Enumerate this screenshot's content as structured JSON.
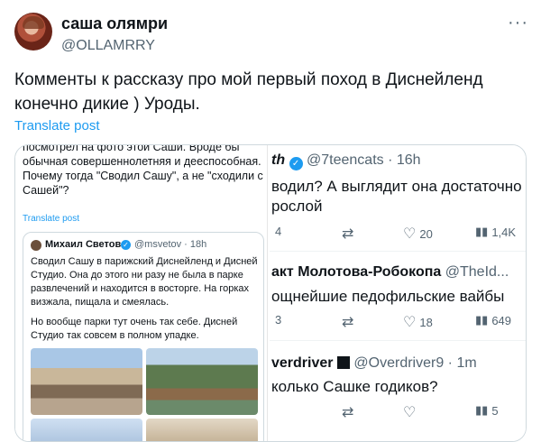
{
  "post": {
    "author_name": "саша олямри",
    "author_handle": "@OLLAMRRY",
    "more_label": "···",
    "text": "Комменты к рассказу про мой первый поход в Диснейленд конечно дикие ) Уроды.",
    "translate_label": "Translate post"
  },
  "left_screenshot": {
    "text": "посмотрел на фото этой Саши. Вроде бы обычная совершеннолетняя и дееспособная. Почему тогда \"Сводил Сашу\", а не \"сходили с Сашей\"?",
    "translate_label": "Translate post",
    "quote": {
      "author_name": "Михаил Светов",
      "author_handle": "@msvetov · 18h",
      "text1": "Сводил Сашу в парижский Диснейленд и Дисней Студио. Она до этого ни разу не была в парке развлечений и находится в восторге. На горках визжала, пищала и смеялась.",
      "text2": "Но вообще парки тут очень так себе. Дисней Студио так совсем в полном упадке."
    }
  },
  "right_screenshot": {
    "tweets": [
      {
        "name": "th",
        "handle": "@7teencats · 16h",
        "body1": "водил? А выглядит она достаточно",
        "body2": "рослой",
        "replies": "4",
        "likes": "20",
        "views": "1,4K"
      },
      {
        "name": "акт Молотова-Робокопа",
        "handle": "@TheId...",
        "body1": "ощнейшие педофильские вайбы",
        "replies": "3",
        "likes": "18",
        "views": "649"
      },
      {
        "name": "verdriver",
        "handle": "@Overdriver9 · 1m",
        "body1": "колько Сашке годиков?",
        "views": "5"
      }
    ]
  },
  "icons": {
    "verified": "verified-badge-icon",
    "reply": "reply-icon",
    "retweet": "retweet-icon",
    "like": "heart-icon",
    "views": "views-icon"
  },
  "colors": {
    "accent": "#1d9bf0",
    "secondary_text": "#536471"
  }
}
